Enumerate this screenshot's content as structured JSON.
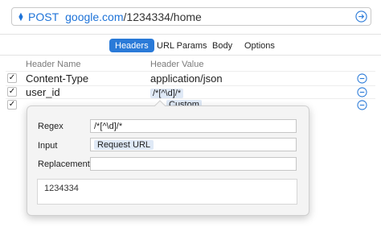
{
  "request": {
    "method": "POST",
    "url_host": "google.com",
    "url_path": "/1234334/home"
  },
  "tabs": [
    {
      "label": "Headers",
      "active": true
    },
    {
      "label": "URL Params",
      "active": false
    },
    {
      "label": "Body",
      "active": false
    },
    {
      "label": "Options",
      "active": false
    }
  ],
  "table": {
    "col_name": "Header Name",
    "col_value": "Header Value",
    "rows": [
      {
        "checked": true,
        "name": "Content-Type",
        "value": "application/json"
      },
      {
        "checked": true,
        "name": "user_id",
        "value": "/*[^\\d]/*"
      },
      {
        "checked": true,
        "name": "",
        "value": "Custom"
      }
    ]
  },
  "popover": {
    "regex_label": "Regex",
    "regex_value": "/*[^\\d]/*",
    "input_label": "Input",
    "input_value": "Request URL",
    "replacement_label": "Replacement",
    "replacement_value": "",
    "result": "1234334"
  },
  "colors": {
    "accent": "#2a7ad8",
    "token": "#dfe9f6"
  },
  "icons": {
    "method_selector": "updown-chevron-icon",
    "send": "arrow-right-circle-icon",
    "remove": "minus-circle-icon",
    "check": "checkmark-icon"
  }
}
